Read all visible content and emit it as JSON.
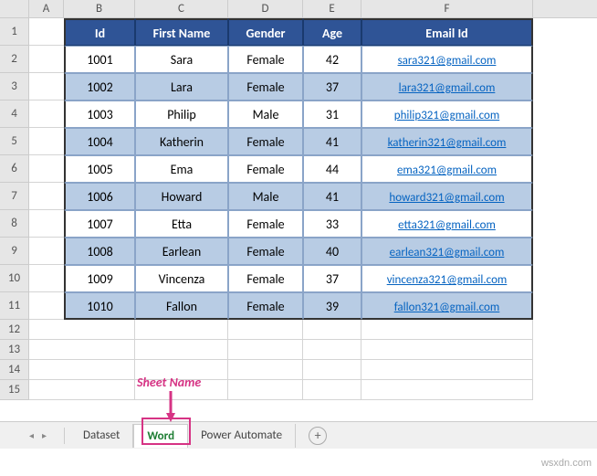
{
  "columns": [
    "A",
    "B",
    "C",
    "D",
    "E",
    "F"
  ],
  "table": {
    "headers": [
      "Id",
      "First Name",
      "Gender",
      "Age",
      "Email Id"
    ],
    "rows": [
      {
        "id": "1001",
        "first": "Sara",
        "gender": "Female",
        "age": "42",
        "email": "sara321@gmail.com"
      },
      {
        "id": "1002",
        "first": "Lara",
        "gender": "Female",
        "age": "37",
        "email": "lara321@gmail.com"
      },
      {
        "id": "1003",
        "first": "Philip",
        "gender": "Male",
        "age": "31",
        "email": "philip321@gmail.com"
      },
      {
        "id": "1004",
        "first": "Katherin",
        "gender": "Female",
        "age": "41",
        "email": "katherin321@gmail.com"
      },
      {
        "id": "1005",
        "first": "Ema",
        "gender": "Female",
        "age": "44",
        "email": "ema321@gmail.com"
      },
      {
        "id": "1006",
        "first": "Howard",
        "gender": "Male",
        "age": "41",
        "email": "howard321@gmail.com"
      },
      {
        "id": "1007",
        "first": "Etta",
        "gender": "Female",
        "age": "33",
        "email": "etta321@gmail.com"
      },
      {
        "id": "1008",
        "first": "Earlean",
        "gender": "Female",
        "age": "40",
        "email": "earlean321@gmail.com"
      },
      {
        "id": "1009",
        "first": "Vincenza",
        "gender": "Female",
        "age": "37",
        "email": "vincenza321@gmail.com"
      },
      {
        "id": "1010",
        "first": "Fallon",
        "gender": "Female",
        "age": "39",
        "email": "fallon321@gmail.com"
      }
    ]
  },
  "annotation": "Sheet Name",
  "tabs": {
    "items": [
      "Dataset",
      "Word",
      "Power Automate"
    ],
    "active": "Word",
    "add_label": "+"
  },
  "nav_icons": {
    "prev": "◂",
    "next": "▸"
  },
  "watermark": "wsxdn.com"
}
